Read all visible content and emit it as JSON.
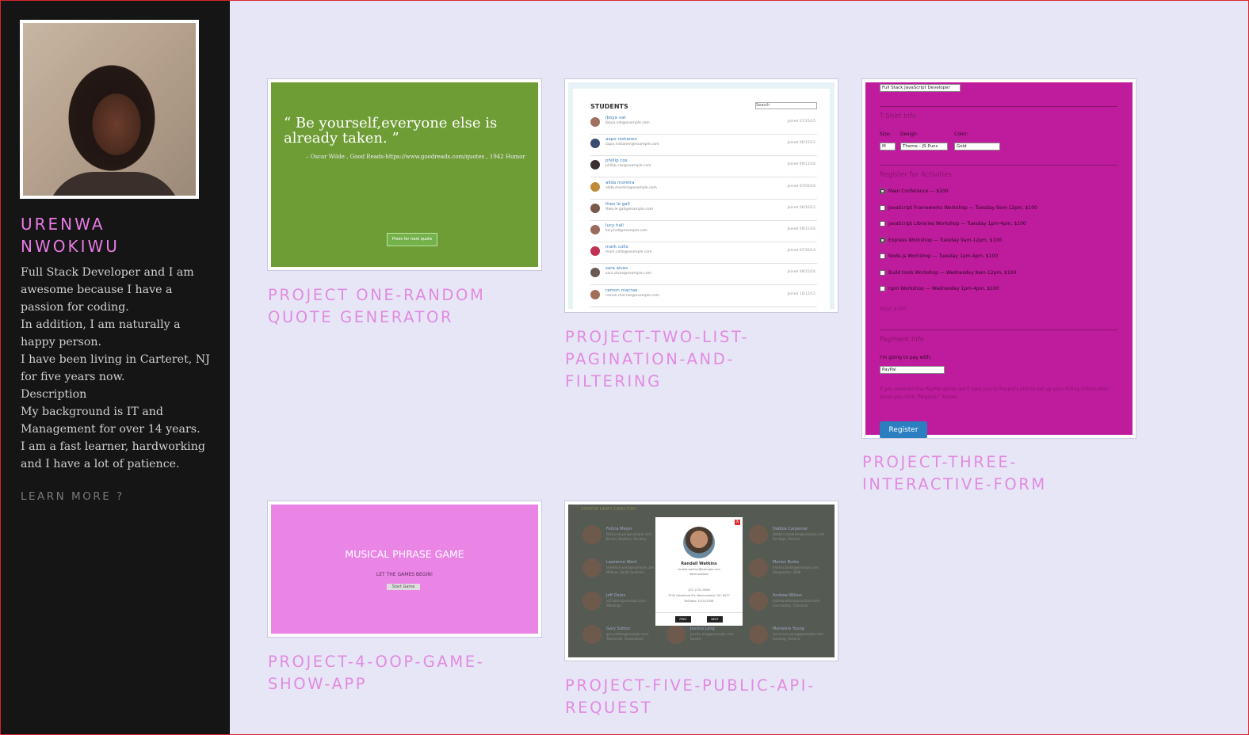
{
  "sidebar": {
    "name": "URENWA NWOKIWU",
    "bio": [
      "Full Stack Developer and I am awesome because I have a passion for coding.",
      "In addition, I am naturally a happy person.",
      "I have been living in Carteret, NJ for five years now.",
      "Description",
      "My background is IT and Management for over 14 years.",
      "I am a fast learner, hardworking and I have a lot of patience."
    ],
    "learn_more": "LEARN MORE ?"
  },
  "projects": [
    {
      "title": "PROJECT ONE-RANDOM QUOTE GENERATOR",
      "quote": "“ Be yourself,everyone else is already taken. ”",
      "source": "– Oscar Wilde , Good Reads-https://www.goodreads.com/quotes , 1942 Humor",
      "button": "Press for next quote"
    },
    {
      "title": "PROJECT-TWO-LIST-PAGINATION-AND-FILTERING",
      "heading": "STUDENTS",
      "search_placeholder": "Search",
      "students": [
        {
          "name": "iboya vat",
          "email": "iboya.vat@example.com",
          "joined": "Joined 07/15/15"
        },
        {
          "name": "aapo niskanen",
          "email": "aapo.niskanen@example.com",
          "joined": "Joined 06/15/12"
        },
        {
          "name": "phillip cox",
          "email": "phillip.cox@example.com",
          "joined": "Joined 09/11/16"
        },
        {
          "name": "ailda moreira",
          "email": "ailda.moreira@example.com",
          "joined": "Joined 07/05/16"
        },
        {
          "name": "theo le gall",
          "email": "theo.le gall@example.com",
          "joined": "Joined 06/16/12"
        },
        {
          "name": "lucy hall",
          "email": "lucy.hall@example.com",
          "joined": "Joined 09/15/16"
        },
        {
          "name": "mark collo",
          "email": "mark.collo@example.com",
          "joined": "Joined 07/16/14"
        },
        {
          "name": "sara alves",
          "email": "sara.alves@example.com",
          "joined": "Joined 09/15/16"
        },
        {
          "name": "ramon macrae",
          "email": "ramon.macrae@example.com",
          "joined": "Joined 10/12/12"
        }
      ]
    },
    {
      "title": "PROJECT-THREE-INTERACTIVE-FORM",
      "job_role": "Full Stack JavaScript Developer",
      "tshirt_heading": "T-Shirt Info",
      "size_label": "Size:",
      "size_value": "M",
      "design_label": "Design:",
      "design_value": "Theme - JS Puns",
      "color_label": "Color:",
      "color_value": "Gold",
      "activities_heading": "Register for Activities",
      "activities": [
        {
          "label": "Main Conference — $200",
          "checked": true
        },
        {
          "label": "JavaScript Frameworks Workshop — Tuesday 9am-12pm, $100",
          "checked": false
        },
        {
          "label": "JavaScript Libraries Workshop — Tuesday 1pm-4pm, $100",
          "checked": false
        },
        {
          "label": "Express Workshop — Tuesday 9am-12pm, $100",
          "checked": true
        },
        {
          "label": "Node.js Workshop — Tuesday 1pm-4pm, $100",
          "checked": false
        },
        {
          "label": "Build tools Workshop — Wednesday 9am-12pm, $100",
          "checked": false
        },
        {
          "label": "npm Workshop — Wednesday 1pm-4pm, $100",
          "checked": false
        }
      ],
      "total": "Total: $300",
      "payment_heading": "Payment Info",
      "pay_label": "I'm going to pay with:",
      "pay_value": "PayPal",
      "paypal_note": "If you selected the PayPal option we'll take you to Paypal's site to set up your billing information, when you click “Register” below.",
      "register": "Register"
    },
    {
      "title": "PROJECT-4-OOP-GAME-SHOW-APP",
      "game_title": "MUSICAL PHRASE GAME",
      "subtitle": "LET THE GAMES BEGIN!",
      "button": "Start Game"
    },
    {
      "title": "PROJECT-FIVE-PUBLIC-API-REQUEST",
      "header": "STARTUP DEAFY DIRECTORY",
      "employees": [
        {
          "name": "Felicia Meyer",
          "email": "felicia.meyer@example.com",
          "loc": "Bristol, Northern Territory"
        },
        {
          "name": "Debbie Carpenter",
          "email": "debbie.carpenter@example.com",
          "loc": "Bendigo, Victoria"
        },
        {
          "name": "Lawrence Ward",
          "email": "lawrence.ward@example.com",
          "loc": "Mildura, South Australia"
        },
        {
          "name": "Marion Burke",
          "email": "marion.burke@example.com",
          "loc": "Shepparton, NSW"
        },
        {
          "name": "Jeff Oates",
          "email": "jeff.oates@example.com",
          "loc": "Wodonga"
        },
        {
          "name": "Andrew Wilson",
          "email": "andrew.wilson@example.com",
          "loc": "Launceston, Tasmania"
        },
        {
          "name": "Gary Sutton",
          "email": "gary.sutton@example.com",
          "loc": "Townsville, Queensland"
        },
        {
          "name": "Jessica Long",
          "email": "jessica.long@example.com",
          "loc": "Darwin"
        },
        {
          "name": "Marianne Young",
          "email": "marianne.young@example.com",
          "loc": "Geelong, Victoria"
        }
      ],
      "modal": {
        "close": "X",
        "name": "Randall Watkins",
        "email": "randall.watkins@example.com",
        "city": "Warrnambool",
        "phone": "(07) 2722-9966",
        "address": "5742 Lakeshore Rd, Warrnambool, VIC 8037",
        "birthday": "Birthday: 10/13/2058",
        "prev": "PREV",
        "next": "NEXT"
      }
    }
  ]
}
